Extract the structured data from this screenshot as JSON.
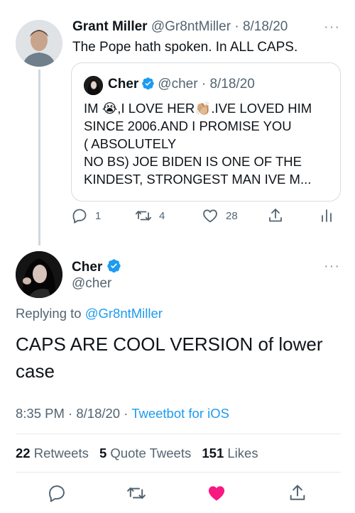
{
  "parent_tweet": {
    "name": "Grant Miller",
    "handle": "@Gr8ntMiller",
    "date": "8/18/20",
    "text": "The Pope hath spoken. In ALL CAPS.",
    "quote": {
      "name": "Cher",
      "handle": "@cher",
      "date": "8/18/20",
      "lines": [
        "IM 😭,I LOVE HER👏🏼.IVE LOVED HIM",
        "SINCE 2006.AND I PROMISE YOU",
        "( ABSOLUTELY",
        "NO BS) JOE BIDEN IS ONE OF THE",
        "KINDEST, STRONGEST MAN IVE M..."
      ]
    },
    "actions": {
      "replies": "1",
      "retweets": "4",
      "likes": "28"
    }
  },
  "main_tweet": {
    "name": "Cher",
    "handle": "@cher",
    "replying_label": "Replying to",
    "replying_to": "@Gr8ntMiller",
    "text": "CAPS ARE COOL VERSION of lower case",
    "time": "8:35 PM",
    "date": "8/18/20",
    "client": "Tweetbot for iOS",
    "stats": {
      "retweets_count": "22",
      "retweets_label": "Retweets",
      "quotes_count": "5",
      "quotes_label": "Quote Tweets",
      "likes_count": "151",
      "likes_label": "Likes"
    }
  },
  "icons": {
    "reply": "reply-icon",
    "retweet": "retweet-icon",
    "like": "heart-icon",
    "share": "share-icon",
    "analytics": "analytics-icon",
    "verified": "verified-badge-icon",
    "more": "more-icon"
  },
  "colors": {
    "accent": "#1d9bf0",
    "like_active": "#f91880",
    "muted": "#536471",
    "text": "#0f1419"
  }
}
